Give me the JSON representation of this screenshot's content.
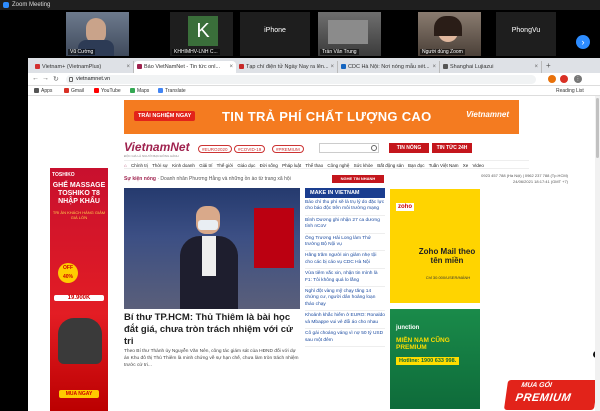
{
  "zoom": {
    "window_title": "Zoom Meeting",
    "participants": [
      {
        "name": "Vũ Cường",
        "type": "video"
      },
      {
        "name": "KHHIMHV-LNH C...",
        "type": "avatar",
        "initial": "K"
      },
      {
        "name": "iPhone",
        "type": "label"
      },
      {
        "name": "Trần Văn Trung",
        "type": "video"
      },
      {
        "name": "Người dùng Zoom",
        "type": "video"
      },
      {
        "name": "PhongVu",
        "type": "label"
      }
    ]
  },
  "browser": {
    "tabs": [
      {
        "label": "Vietnam+ (VietnamPlus)",
        "active": false,
        "color": "#d32f2f"
      },
      {
        "label": "Báo VietNamNet - Tin tức onl...",
        "active": true,
        "color": "#9f224e"
      },
      {
        "label": "Tạp chí điện tử Ngày Nay ra lên...",
        "active": false,
        "color": "#c62828"
      },
      {
        "label": "CDC Hà Nội: Nơi nóng mẫu xét...",
        "active": false,
        "color": "#1565c0"
      },
      {
        "label": "Shanghai Lujiazui",
        "active": false,
        "color": "#555555"
      }
    ],
    "url": "vietnamnet.vn",
    "bookmarks": [
      {
        "label": "Apps",
        "color": "#555555"
      },
      {
        "label": "Gmail",
        "color": "#d93025"
      },
      {
        "label": "YouTube",
        "color": "#ff0000"
      },
      {
        "label": "Maps",
        "color": "#34a853"
      },
      {
        "label": "Translate",
        "color": "#4285f4"
      }
    ],
    "reading_list": "Reading List"
  },
  "site": {
    "banner": {
      "button": "TRẢI NGHIỆM NGAY",
      "text": "TIN TRẢ PHÍ CHẤT LƯỢNG CAO",
      "logo": "Vietnamnet"
    },
    "logo": "VietnamNet",
    "logo_sub": "ĐỘC GIẢ LÀ NGƯỜI BẠN ĐỒNG HÀNH",
    "tags": [
      "#EURO2020",
      "#COVID-19",
      "#PREMIUM"
    ],
    "hot_btn": "TIN NÓNG",
    "news24_btn": "TIN TỨC 24H",
    "menu": [
      "Chính trị",
      "Thời sự",
      "Kinh doanh",
      "Giải trí",
      "Thế giới",
      "Giáo dục",
      "Đời sống",
      "Pháp luật",
      "Thể thao",
      "Công nghệ",
      "Sức khỏe",
      "Bất động sản",
      "Bạn đọc",
      "Tuần Việt Nam",
      "Xe",
      "Video"
    ],
    "hot_label": "Sự kiện nóng",
    "hot_items": "Doanh nhân Phương Hằng và những ồn ào từ trang xã hội",
    "tv_badge": "NGHE TIN NHANH",
    "contact_line1": "0923 457 788 (Hà Nội) | 0962 237 788 (Tp.HCM)",
    "contact_line2": "24/06/2021 18:17:41 (GMT +7)",
    "hero": {
      "title": "Bí thư TP.HCM: Thủ Thiêm là bài học đắt giá, chưa tròn trách nhiệm với cử tri",
      "summary": "Theo Bí thư Thành ủy Nguyễn Văn Nên, công tác giám sát của HĐND đối với dự án Khu đô thị Thủ Thiêm là minh chứng về sự hạn chế, chưa làm tròn trách nhiệm trước cử tri..."
    },
    "make_in_vietnam": "MAKE IN VIETNAM",
    "news": [
      "Báo chí thu phí sẽ là trụ lý do đặc lực cho báo độc trên môi trường mạng",
      "Bình Dương ghi nhận 27 ca dương tính nCoV",
      "Ông Trương Hải Long làm Thứ trưởng Bộ Nội vụ",
      "Hãng trăm người xin giảm nhẹ tội cho các bị cáo vụ CDC Hà Nội",
      "Vừa tiêm vắc xin, nhận tin mình là F1: Tôi không quá lo lắng",
      "Nghỉ đột vàng mỹ chạy tăng 14 chứng cư, người dân hoảng loạn tháo chạy",
      "Khoảnh khắc hiếm ở EURO: Ronaldo và Mbappe vui vẻ đổi áo cho nhau",
      "Cô gái choáng váng vì nợ 50 tỷ USD sau một đêm"
    ],
    "zoho": {
      "logo": "zoho",
      "title": "Zoho Mail theo tên miền",
      "desc": "Chỉ 30.000/USER/MÁNH"
    },
    "junction": {
      "logo": "junction",
      "title": "MIỄN NAM CŨNG PREMIUM",
      "hotline": "Hotline: 1900 633 998."
    },
    "premium": {
      "top": "MUA GÓI",
      "bottom": "PREMIUM"
    },
    "sidead": {
      "brand": "TOSHIKO",
      "title": "GHẾ MASSAGE TOSHIKO T8 NHẬP KHẨU",
      "sub": "TRI ÂN KHÁCH HÀNG GIẢM GIÁ LỚN",
      "off": "OFF 40%",
      "price": "19.900K",
      "buy": "MUA NGAY"
    }
  }
}
